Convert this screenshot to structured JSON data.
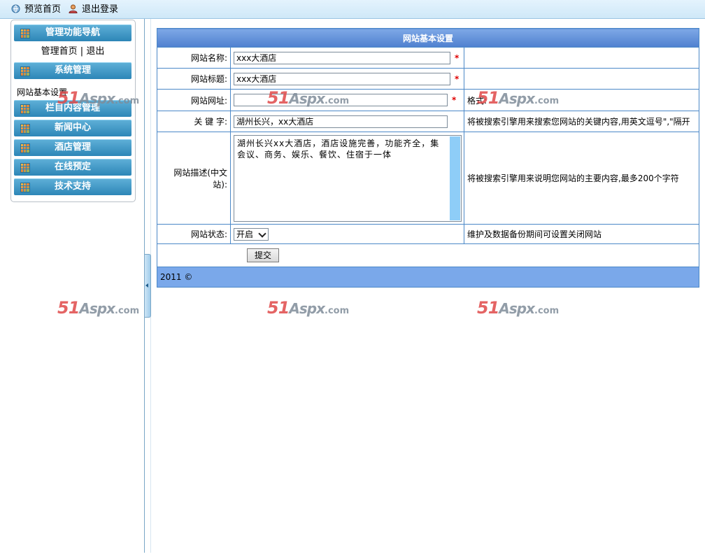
{
  "topbar": {
    "preview_home": "预览首页",
    "logout": "退出登录"
  },
  "sidebar": {
    "header_nav": "管理功能导航",
    "sub_links": {
      "home": "管理首页",
      "sep": "|",
      "exit": "退出"
    },
    "header_system": "系统管理",
    "system_item": "网站基本设置",
    "header_content": "栏目内容管理",
    "header_news": "新闻中心",
    "header_hotel": "酒店管理",
    "header_booking": "在线预定",
    "header_support": "技术支持"
  },
  "form": {
    "title": "网站基本设置",
    "site_name_label": "网站名称:",
    "site_name_value": "xxx大酒店",
    "site_title_label": "网站标题:",
    "site_title_value": "xxx大酒店",
    "site_url_label": "网站网址:",
    "site_url_value": "",
    "site_url_hint": "格式:",
    "keywords_label": "关 键 字:",
    "keywords_value": "湖州长兴，xx大酒店",
    "keywords_hint": "将被搜索引擎用来搜索您网站的关键内容,用英文逗号\",\"隔开",
    "desc_label": "网站描述(中文站):",
    "desc_value": "湖州长兴xx大酒店，酒店设施完善，功能齐全，集会议、商务、娱乐、餐饮、住宿于一体",
    "desc_hint": "将被搜索引擎用来说明您网站的主要内容,最多200个字符",
    "status_label": "网站状态:",
    "status_value": "开启",
    "status_hint": "维护及数据备份期间可设置关闭网站",
    "required_mark": "*",
    "submit": "提交",
    "footer": "2011 ©"
  },
  "watermark": {
    "part1": "51",
    "part2": "Aspx",
    "part3": ".com"
  },
  "colors": {
    "header_blue": "#2d86b7",
    "table_border": "#4b88c8",
    "footer_bg": "#7aa8ea"
  }
}
